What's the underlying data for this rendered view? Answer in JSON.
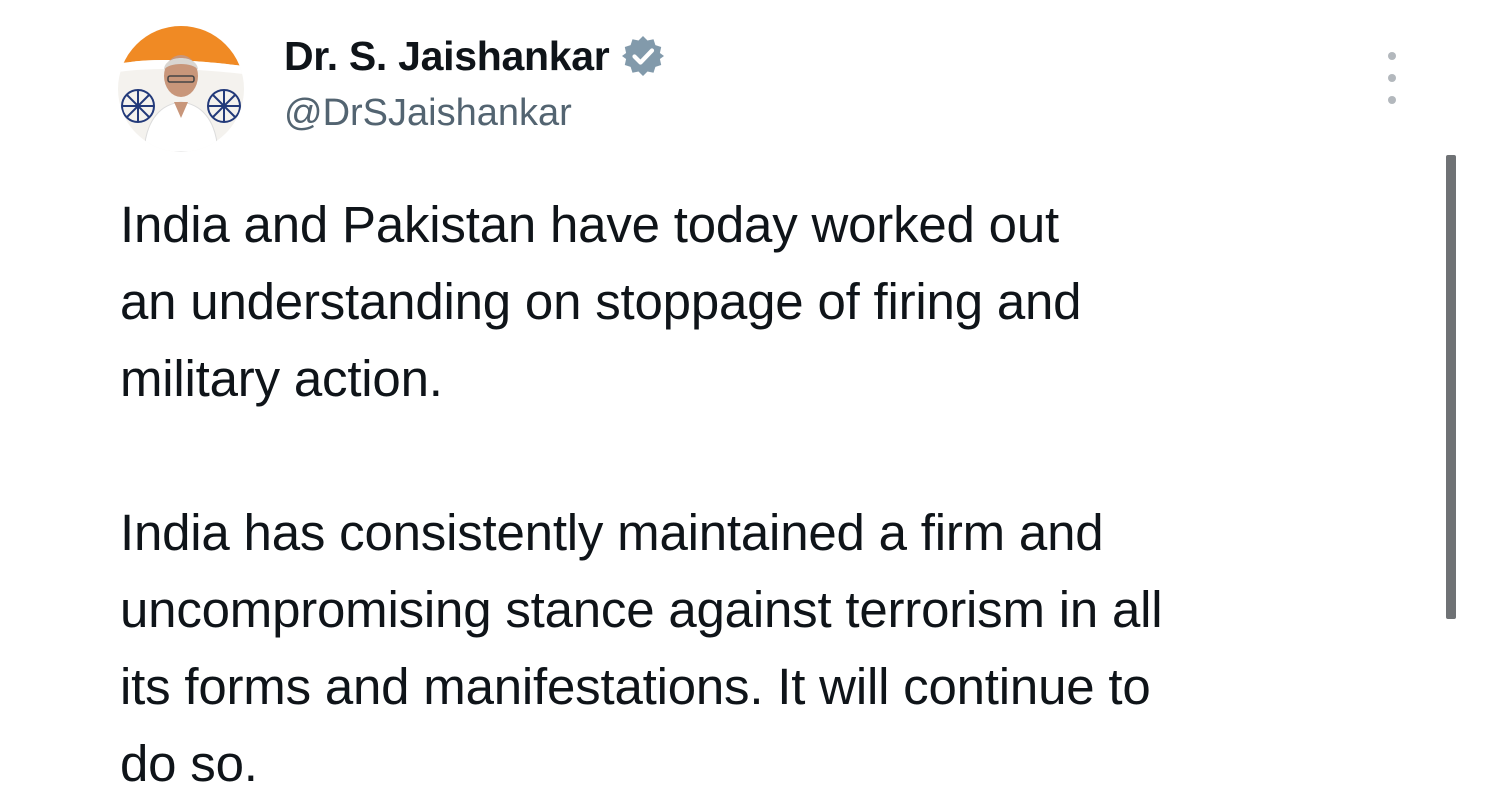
{
  "tweet": {
    "author": {
      "display_name": "Dr. S. Jaishankar",
      "handle": "@DrSJaishankar",
      "verified": true,
      "avatar_icon": "profile-photo"
    },
    "more_icon": "vertical-ellipsis-icon",
    "paragraphs": [
      "India and Pakistan have today worked out\nan understanding on stoppage of firing and\nmilitary action.",
      "India has consistently maintained a firm and\nuncompromising stance against terrorism in all\nits forms and manifestations. It will continue to\ndo so."
    ]
  },
  "colors": {
    "text": "#0f1419",
    "secondary_text": "#536471",
    "verified_badge": "#829aab",
    "scrollbar": "#6f7275",
    "flag_saffron": "#f08a24"
  }
}
